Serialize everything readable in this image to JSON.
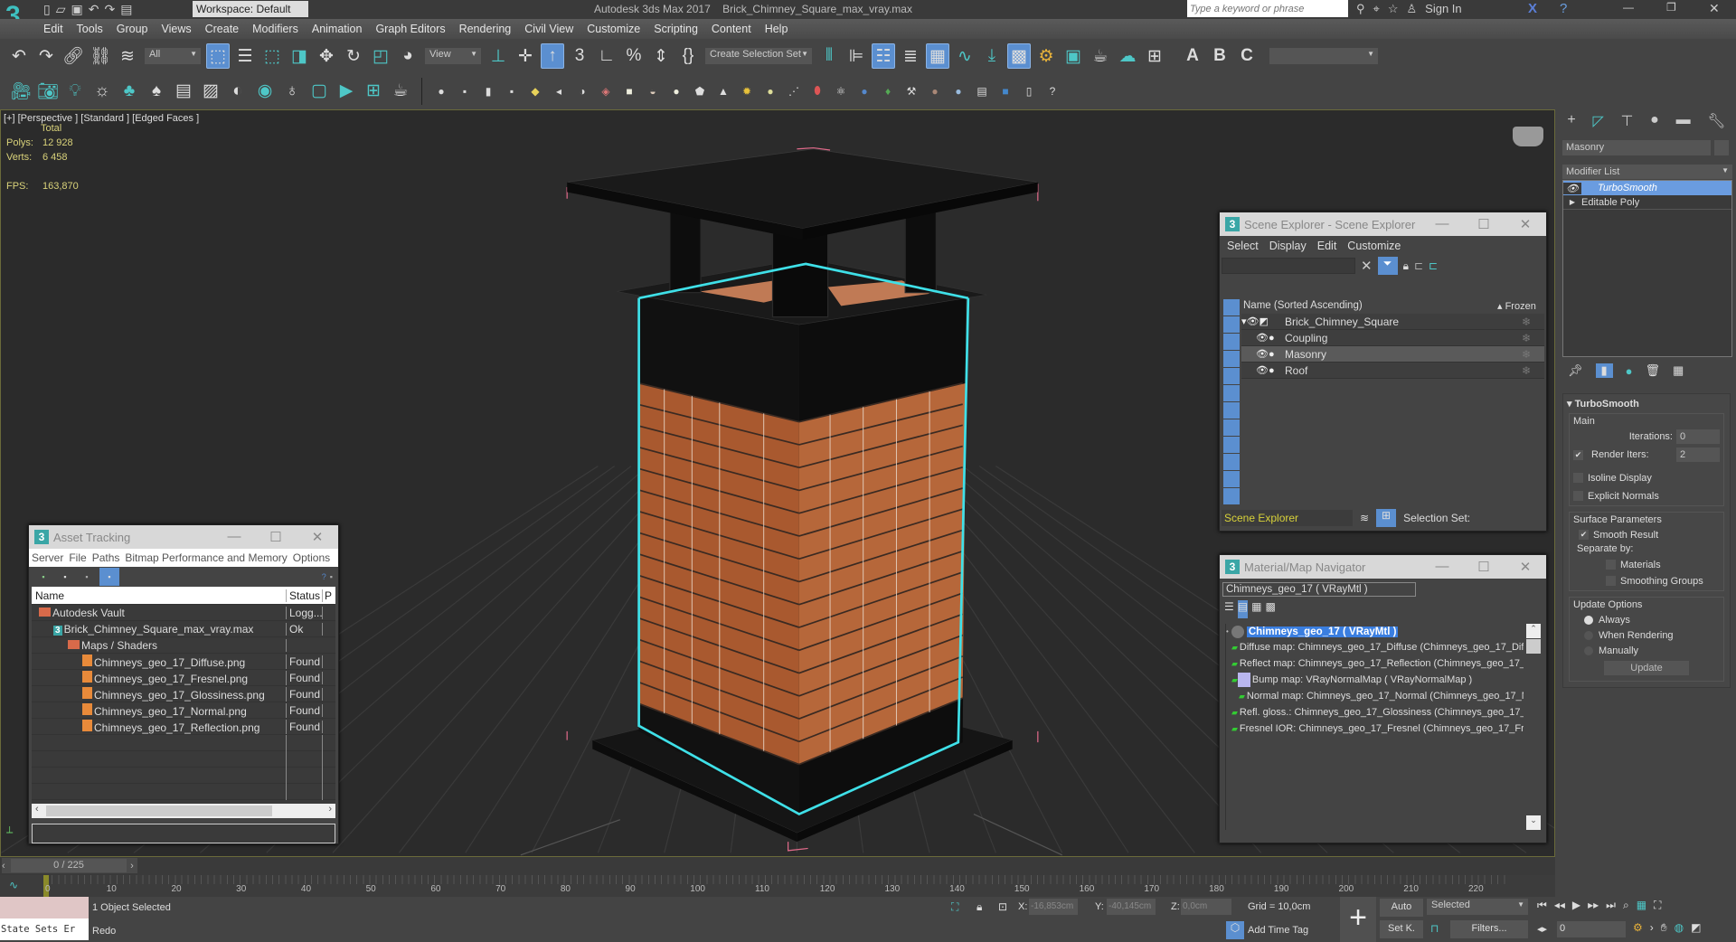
{
  "app": {
    "title": "Autodesk 3ds Max 2017",
    "file": "Brick_Chimney_Square_max_vray.max",
    "workspace": "Workspace: Default",
    "search_placeholder": "Type a keyword or phrase",
    "sign_in": "Sign In"
  },
  "menu": [
    "Edit",
    "Tools",
    "Group",
    "Views",
    "Create",
    "Modifiers",
    "Animation",
    "Graph Editors",
    "Rendering",
    "Civil View",
    "Customize",
    "Scripting",
    "Content",
    "Help"
  ],
  "toolbar": {
    "filter": "All",
    "ref_coord": "View",
    "selection_set": "Create Selection Set"
  },
  "viewport": {
    "label": "[+] [Perspective ] [Standard ] [Edged Faces ]",
    "total": "Total",
    "polys_label": "Polys:",
    "polys": "12 928",
    "verts_label": "Verts:",
    "verts": "6 458",
    "fps_label": "FPS:",
    "fps": "163,870"
  },
  "scene_explorer": {
    "title": "Scene Explorer - Scene Explorer",
    "menu": [
      "Select",
      "Display",
      "Edit",
      "Customize"
    ],
    "col_name": "Name (Sorted Ascending)",
    "col_frozen": "Frozen",
    "root": "Brick_Chimney_Square",
    "children": [
      "Coupling",
      "Masonry",
      "Roof"
    ],
    "selected": "Masonry",
    "footer_name": "Scene Explorer",
    "selection_set": "Selection Set:"
  },
  "mat_nav": {
    "title": "Material/Map Navigator",
    "current": "Chimneys_geo_17  ( VRayMtl )",
    "root": "Chimneys_geo_17  ( VRayMtl )",
    "items": [
      {
        "text": "Diffuse map: Chimneys_geo_17_Diffuse (Chimneys_geo_17_Diff",
        "thumb": "#6b3a22",
        "indent": 0
      },
      {
        "text": "Reflect map: Chimneys_geo_17_Reflection (Chimneys_geo_17_I",
        "thumb": "#eeeeee",
        "indent": 0
      },
      {
        "text": "Bump map: VRayNormalMap  ( VRayNormalMap )",
        "thumb": "#b9b6ef",
        "indent": 0
      },
      {
        "text": "Normal map: Chimneys_geo_17_Normal (Chimneys_geo_17_N",
        "thumb": "#b9b6ef",
        "indent": 1
      },
      {
        "text": "Refl. gloss.: Chimneys_geo_17_Glossiness (Chimneys_geo_17_G",
        "thumb": "#aaaaaa",
        "indent": 0
      },
      {
        "text": "Fresnel IOR: Chimneys_geo_17_Fresnel (Chimneys_geo_17_Fre",
        "thumb": "#111111",
        "indent": 0
      }
    ]
  },
  "asset_tracking": {
    "title": "Asset Tracking",
    "menu": [
      "Server",
      "File",
      "Paths",
      "Bitmap Performance and Memory",
      "Options"
    ],
    "col_name": "Name",
    "col_status": "Status",
    "col_p": "P",
    "rows": [
      {
        "name": "Autodesk Vault",
        "status": "Logg...",
        "indent": 0,
        "icon": "vault"
      },
      {
        "name": "Brick_Chimney_Square_max_vray.max",
        "status": "Ok",
        "indent": 1,
        "icon": "max"
      },
      {
        "name": "Maps / Shaders",
        "status": "",
        "indent": 2,
        "icon": "vault"
      },
      {
        "name": "Chimneys_geo_17_Diffuse.png",
        "status": "Found",
        "indent": 3,
        "icon": "png"
      },
      {
        "name": "Chimneys_geo_17_Fresnel.png",
        "status": "Found",
        "indent": 3,
        "icon": "png"
      },
      {
        "name": "Chimneys_geo_17_Glossiness.png",
        "status": "Found",
        "indent": 3,
        "icon": "png"
      },
      {
        "name": "Chimneys_geo_17_Normal.png",
        "status": "Found",
        "indent": 3,
        "icon": "png"
      },
      {
        "name": "Chimneys_geo_17_Reflection.png",
        "status": "Found",
        "indent": 3,
        "icon": "png"
      }
    ]
  },
  "command_panel": {
    "object_name": "Masonry",
    "modifier_list": "Modifier List",
    "stack": [
      "TurboSmooth",
      "Editable Poly"
    ],
    "rollout": "TurboSmooth",
    "main": "Main",
    "iterations_label": "Iterations:",
    "iterations": "0",
    "render_iters_label": "Render Iters:",
    "render_iters": "2",
    "isoline": "Isoline Display",
    "explicit": "Explicit Normals",
    "surface": "Surface Parameters",
    "smooth_result": "Smooth Result",
    "separate_by": "Separate by:",
    "materials": "Materials",
    "smoothing_groups": "Smoothing Groups",
    "update_options": "Update Options",
    "always": "Always",
    "when_rendering": "When Rendering",
    "manually": "Manually",
    "update": "Update"
  },
  "timeline": {
    "frame": "0 / 225",
    "current": 0,
    "total": 225,
    "ticks": [
      "0",
      "10",
      "20",
      "30",
      "40",
      "50",
      "60",
      "70",
      "80",
      "90",
      "100",
      "110",
      "120",
      "130",
      "140",
      "150",
      "160",
      "170",
      "180",
      "190",
      "200",
      "210",
      "220"
    ]
  },
  "status": {
    "selected": "1 Object Selected",
    "prompt": "Redo",
    "script_listener": "State Sets Er",
    "x_label": "X:",
    "x": "-16,853cm",
    "y_label": "Y:",
    "y": "-40,145cm",
    "z_label": "Z:",
    "z": "0,0cm",
    "grid": "Grid = 10,0cm",
    "add_time_tag": "Add Time Tag",
    "auto": "Auto",
    "set_key": "Set K.",
    "key_filter": "Selected",
    "filters": "Filters...",
    "frame_field": "0"
  },
  "colors": {
    "accent": "#5b8fd0",
    "selection": "#3fe0e8",
    "brick": "#b5643a",
    "viewport_text": "#d9d27a"
  }
}
